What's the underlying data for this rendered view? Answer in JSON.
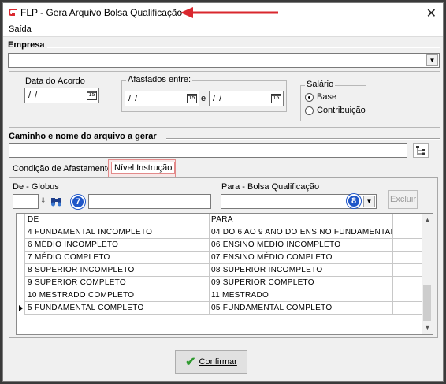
{
  "window": {
    "title": "FLP - Gera Arquivo Bolsa Qualificação",
    "close_glyph": "✕"
  },
  "menu": {
    "items": [
      {
        "label": "Saída"
      }
    ]
  },
  "empresa": {
    "label": "Empresa",
    "value": ""
  },
  "data_acordo": {
    "label": "Data do Acordo",
    "value": "/ /",
    "calendar_icon_text": "15"
  },
  "afastados": {
    "label": "Afastados entre:",
    "from_value": "/ /",
    "to_value": "/ /",
    "separator": "e",
    "calendar_icon_text": "15"
  },
  "salario": {
    "label": "Salário",
    "options": [
      {
        "label": "Base",
        "selected": true
      },
      {
        "label": "Contribuição",
        "selected": false
      }
    ]
  },
  "caminho": {
    "label": "Caminho e nome do arquivo a gerar",
    "value": ""
  },
  "tabs": [
    {
      "label": "Condição de Afastamento",
      "active": false
    },
    {
      "label": "Nível Instrução",
      "active": true
    }
  ],
  "de_globus": {
    "label": "De - Globus",
    "code_value": "",
    "description_value": "",
    "badge": "7"
  },
  "para_bolsa": {
    "label": "Para - Bolsa Qualificação",
    "value": "",
    "badge": "8"
  },
  "excluir_button": {
    "label": "Excluir"
  },
  "grid": {
    "columns": [
      "DE",
      "PARA"
    ],
    "rows": [
      {
        "de": "4 FUNDAMENTAL INCOMPLETO",
        "para": "04  DO 6 AO 9 ANO DO ENSINO FUNDAMENTAL",
        "current": false
      },
      {
        "de": "6 MÉDIO INCOMPLETO",
        "para": "06  ENSINO MÉDIO INCOMPLETO",
        "current": false
      },
      {
        "de": "7 MÉDIO COMPLETO",
        "para": "07  ENSINO MÉDIO COMPLETO",
        "current": false
      },
      {
        "de": "8 SUPERIOR INCOMPLETO",
        "para": "08  SUPERIOR INCOMPLETO",
        "current": false
      },
      {
        "de": "9 SUPERIOR COMPLETO",
        "para": "09  SUPERIOR COMPLETO",
        "current": false
      },
      {
        "de": "10 MESTRADO COMPLETO",
        "para": "11  MESTRADO",
        "current": false
      },
      {
        "de": "5 FUNDAMENTAL COMPLETO",
        "para": "05  FUNDAMENTAL COMPLETO",
        "current": true
      }
    ]
  },
  "confirmar_button": {
    "label": "Confirmar",
    "icon": "check-icon"
  },
  "colors": {
    "title_bar_bg": "#ffffff",
    "window_bg": "#f0f0f0",
    "annotation_arrow": "#d9272e",
    "badge_blue": "#1f56c8",
    "check_green": "#2e9a2e",
    "app_logo_red": "#d9272e"
  }
}
